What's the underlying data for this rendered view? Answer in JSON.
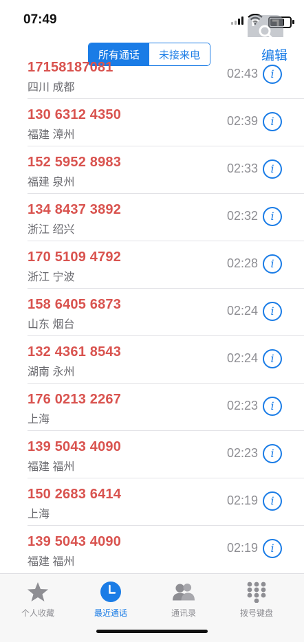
{
  "status_bar": {
    "time": "07:49"
  },
  "nav": {
    "segments": [
      "所有通话",
      "未接来电"
    ],
    "edit": "编辑"
  },
  "calls": [
    {
      "number": "17158187081",
      "location": "四川 成都",
      "time": "02:43"
    },
    {
      "number": "130 6312 4350",
      "location": "福建 漳州",
      "time": "02:39"
    },
    {
      "number": "152 5952 8983",
      "location": "福建 泉州",
      "time": "02:33"
    },
    {
      "number": "134 8437 3892",
      "location": "浙江 绍兴",
      "time": "02:32"
    },
    {
      "number": "170 5109 4792",
      "location": "浙江 宁波",
      "time": "02:28"
    },
    {
      "number": "158 6405 6873",
      "location": "山东 烟台",
      "time": "02:24"
    },
    {
      "number": "132 4361 8543",
      "location": "湖南 永州",
      "time": "02:24"
    },
    {
      "number": "176 0213 2267",
      "location": "上海",
      "time": "02:23"
    },
    {
      "number": "139 5043 4090",
      "location": "福建 福州",
      "time": "02:23"
    },
    {
      "number": "150 2683 6414",
      "location": "上海",
      "time": "02:19"
    },
    {
      "number": "139 5043 4090",
      "location": "福建 福州",
      "time": "02:19"
    }
  ],
  "tabs": [
    {
      "label": "个人收藏",
      "icon": "star-icon"
    },
    {
      "label": "最近通话",
      "icon": "clock-icon"
    },
    {
      "label": "通讯录",
      "icon": "contacts-icon"
    },
    {
      "label": "拨号键盘",
      "icon": "keypad-icon"
    }
  ],
  "colors": {
    "accent": "#1a7ce6",
    "missed_call": "#d9534f"
  }
}
